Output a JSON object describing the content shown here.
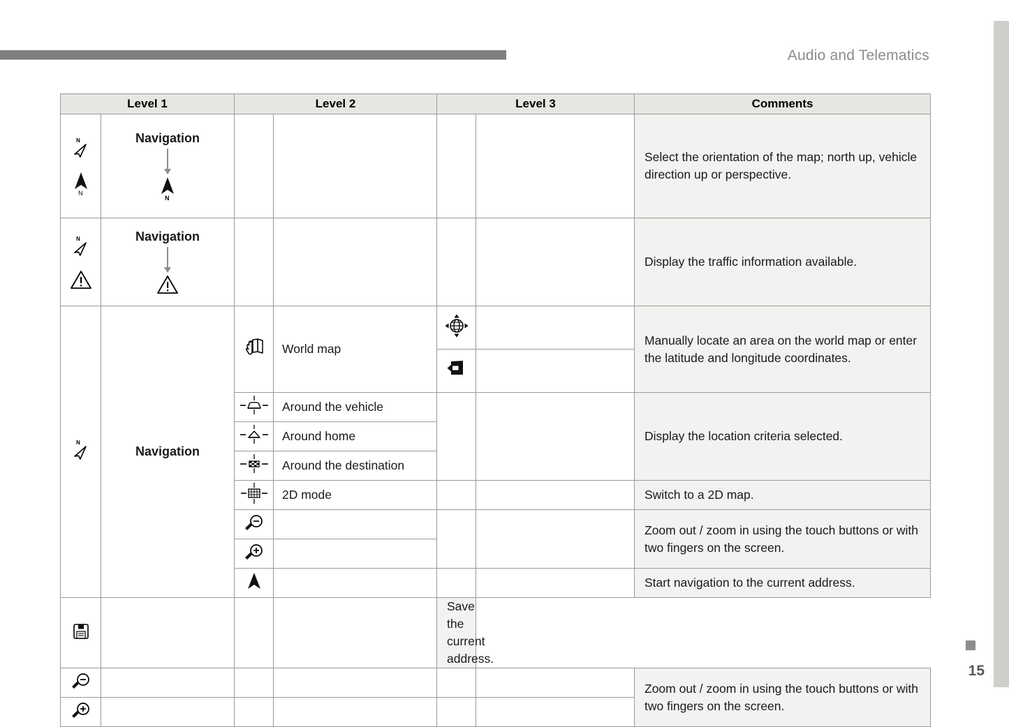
{
  "page": {
    "header_title": "Audio and Telematics",
    "page_number": "15"
  },
  "table": {
    "columns": [
      "Level 1",
      "Level 2",
      "Level 3",
      "Comments"
    ],
    "rows": [
      {
        "level1_icons": [
          "compass-nw-outline-icon",
          "north-arrow-filled-icon"
        ],
        "level1_label": "Navigation",
        "level1_target_icon": "north-arrow-filled-icon",
        "level2": "",
        "level3": "",
        "comment": "Select the orientation of the map; north up, vehicle direction up or perspective."
      },
      {
        "level1_icons": [
          "compass-nw-outline-icon",
          "warning-triangle-icon"
        ],
        "level1_label": "Navigation",
        "level1_target_icon": "warning-triangle-icon",
        "level2": "",
        "level3": "",
        "comment": "Display the traffic information available."
      },
      {
        "level1_icons": [
          "compass-nw-outline-icon"
        ],
        "level1_label": "Navigation",
        "sub_rows": [
          {
            "level2_icon": "hand-map-icon",
            "level2": "World map",
            "level3_icons": [
              "globe-pan-icon",
              "return-arrow-icon"
            ],
            "comment": "Manually locate an area on the world map or enter the latitude and longitude coordinates."
          },
          {
            "level2_icon": "around-vehicle-icon",
            "level2": "Around the vehicle",
            "level3_icons": [],
            "comment": "Display the location criteria selected."
          },
          {
            "level2_icon": "around-home-icon",
            "level2": "Around home",
            "level3_icons": [],
            "comment": ""
          },
          {
            "level2_icon": "around-destination-icon",
            "level2": "Around the destination",
            "level3_icons": [],
            "comment": ""
          },
          {
            "level2_icon": "2d-grid-icon",
            "level2": "2D mode",
            "level3_icons": [],
            "comment": "Switch to a 2D map."
          },
          {
            "level2_icon": "zoom-out-icon",
            "level2": "",
            "level3_icons": [],
            "comment": "Zoom out / zoom in using the touch buttons or with two fingers on the screen."
          },
          {
            "level2_icon": "zoom-in-icon",
            "level2": "",
            "level3_icons": [],
            "comment": ""
          },
          {
            "level2_icon": "navigate-arrow-icon",
            "level2": "",
            "level3_icons": [],
            "comment": "Start navigation to the current address."
          },
          {
            "level2_icon": "save-floppy-icon",
            "level2": "",
            "level3_icons": [],
            "comment": "Save the current address."
          }
        ]
      },
      {
        "level1_icons": [
          "zoom-out-icon"
        ],
        "level1_label": "",
        "level2": "",
        "level3": "",
        "comment": "Zoom out / zoom in using the touch buttons or with two fingers on the screen."
      },
      {
        "level1_icons": [
          "zoom-in-icon"
        ],
        "level1_label": "",
        "level2": "",
        "level3": "",
        "comment": ""
      }
    ]
  },
  "colors": {
    "header_bar": "#808080",
    "header_text": "#8b8b8b",
    "comment_bg": "#f2f2f0",
    "table_header_bg": "#e6e6e2",
    "edge_bar": "#cdcfca",
    "grid_line": "#9a9a9a"
  }
}
